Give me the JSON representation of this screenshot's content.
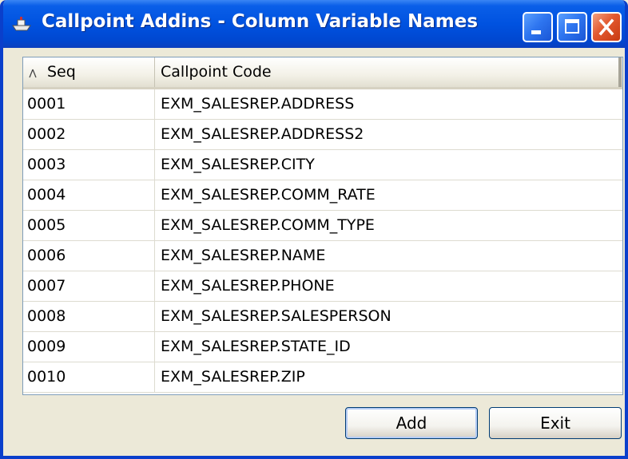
{
  "window": {
    "title": "Callpoint Addins - Column Variable Names",
    "app_icon": "ship-icon",
    "controls": {
      "minimize": "minimize-icon",
      "maximize": "maximize-icon",
      "close": "close-icon"
    }
  },
  "grid": {
    "columns": [
      {
        "label": "Seq",
        "sorted": "ascending"
      },
      {
        "label": "Callpoint Code"
      }
    ],
    "rows": [
      {
        "seq": "0001",
        "code": "EXM_SALESREP.ADDRESS"
      },
      {
        "seq": "0002",
        "code": "EXM_SALESREP.ADDRESS2"
      },
      {
        "seq": "0003",
        "code": "EXM_SALESREP.CITY"
      },
      {
        "seq": "0004",
        "code": "EXM_SALESREP.COMM_RATE"
      },
      {
        "seq": "0005",
        "code": "EXM_SALESREP.COMM_TYPE"
      },
      {
        "seq": "0006",
        "code": "EXM_SALESREP.NAME"
      },
      {
        "seq": "0007",
        "code": "EXM_SALESREP.PHONE"
      },
      {
        "seq": "0008",
        "code": "EXM_SALESREP.SALESPERSON"
      },
      {
        "seq": "0009",
        "code": "EXM_SALESREP.STATE_ID"
      },
      {
        "seq": "0010",
        "code": "EXM_SALESREP.ZIP"
      }
    ]
  },
  "buttons": {
    "add": "Add",
    "exit": "Exit"
  },
  "colors": {
    "titlebar": "#0052e0",
    "frame": "#0a3fcb",
    "dialog_bg": "#ece9d8",
    "close_button": "#e2582e"
  }
}
